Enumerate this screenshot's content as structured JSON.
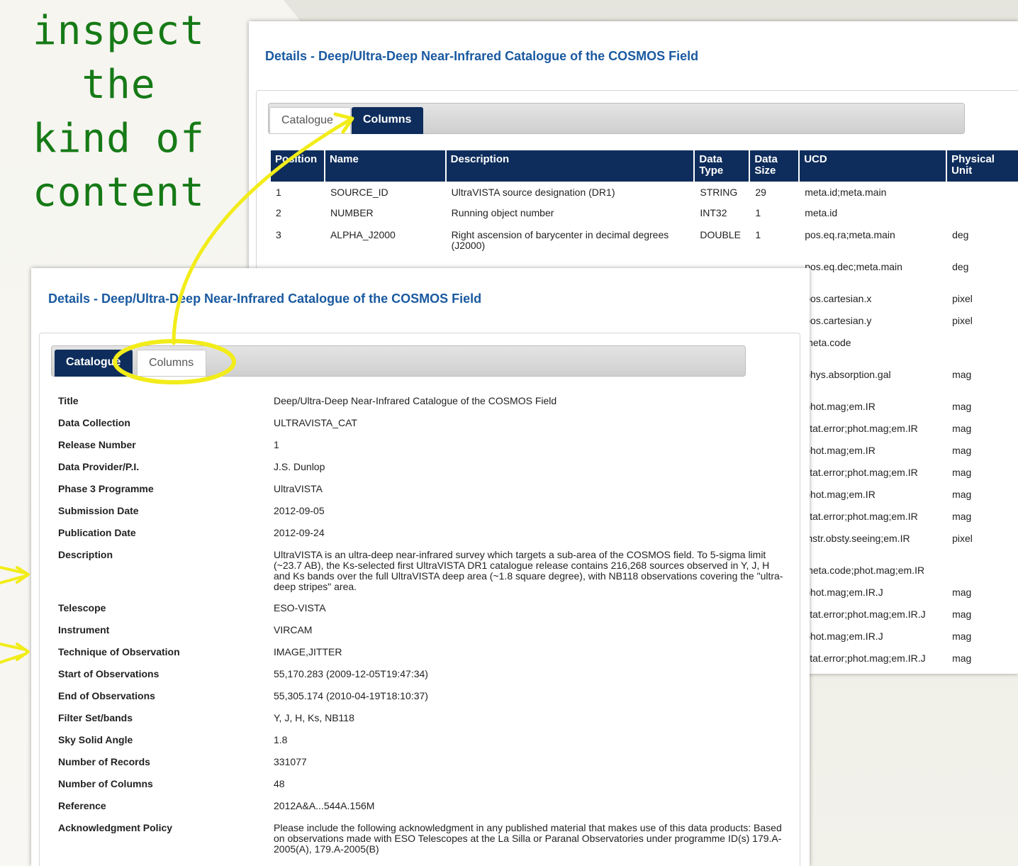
{
  "annotation": {
    "headline_lines": [
      "inspect the",
      "kind of",
      "content"
    ],
    "accent_color": "#167a16",
    "highlight_color": "#f2ec1a"
  },
  "columns_view": {
    "heading": "Details - Deep/Ultra-Deep Near-Infrared Catalogue of the COSMOS Field",
    "tabs": {
      "catalogue": "Catalogue",
      "columns": "Columns"
    },
    "table": {
      "headers": [
        "Position",
        "Name",
        "Description",
        "Data Type",
        "Data Size",
        "UCD",
        "Physical Unit"
      ],
      "rows": [
        {
          "position": "1",
          "name": "SOURCE_ID",
          "description": "UltraVISTA source designation (DR1)",
          "type": "STRING",
          "size": "29",
          "ucd": "meta.id;meta.main",
          "unit": ""
        },
        {
          "position": "2",
          "name": "NUMBER",
          "description": "Running object number",
          "type": "INT32",
          "size": "1",
          "ucd": "meta.id",
          "unit": ""
        },
        {
          "position": "3",
          "name": "ALPHA_J2000",
          "description": "Right ascension of barycenter in decimal degrees (J2000)",
          "type": "DOUBLE",
          "size": "1",
          "ucd": "pos.eq.ra;meta.main",
          "unit": "deg"
        },
        {
          "position": "",
          "name": "",
          "description": "",
          "type": "",
          "size": "",
          "ucd": "pos.eq.dec;meta.main",
          "unit": "deg"
        },
        {
          "position": "",
          "name": "",
          "description": "",
          "type": "",
          "size": "",
          "ucd": "pos.cartesian.x",
          "unit": "pixel"
        },
        {
          "position": "",
          "name": "",
          "description": "",
          "type": "",
          "size": "",
          "ucd": "pos.cartesian.y",
          "unit": "pixel"
        },
        {
          "position": "",
          "name": "",
          "description": "",
          "type": "",
          "size": "",
          "ucd": "meta.code",
          "unit": ""
        },
        {
          "position": "",
          "name": "",
          "description": "",
          "type": "",
          "size": "",
          "ucd": "phys.absorption.gal",
          "unit": "mag"
        },
        {
          "position": "",
          "name": "",
          "description": "",
          "type": "",
          "size": "",
          "ucd": "phot.mag;em.IR",
          "unit": "mag"
        },
        {
          "position": "",
          "name": "",
          "description": "",
          "type": "",
          "size": "",
          "ucd": "stat.error;phot.mag;em.IR",
          "unit": "mag"
        },
        {
          "position": "",
          "name": "",
          "description": "",
          "type": "",
          "size": "",
          "ucd": "phot.mag;em.IR",
          "unit": "mag"
        },
        {
          "position": "",
          "name": "",
          "description": "",
          "type": "",
          "size": "",
          "ucd": "stat.error;phot.mag;em.IR",
          "unit": "mag"
        },
        {
          "position": "",
          "name": "",
          "description": "",
          "type": "",
          "size": "",
          "ucd": "phot.mag;em.IR",
          "unit": "mag"
        },
        {
          "position": "",
          "name": "",
          "description": "",
          "type": "",
          "size": "",
          "ucd": "stat.error;phot.mag;em.IR",
          "unit": "mag"
        },
        {
          "position": "",
          "name": "",
          "description": "",
          "type": "",
          "size": "",
          "ucd": "instr.obsty.seeing;em.IR",
          "unit": "pixel"
        },
        {
          "position": "",
          "name": "",
          "description": "",
          "type": "",
          "size": "",
          "ucd": "meta.code;phot.mag;em.IR",
          "unit": ""
        },
        {
          "position": "",
          "name": "",
          "description": "",
          "type": "",
          "size": "",
          "ucd": "phot.mag;em.IR.J",
          "unit": "mag"
        },
        {
          "position": "",
          "name": "",
          "description": "",
          "type": "",
          "size": "",
          "ucd": "stat.error;phot.mag;em.IR.J",
          "unit": "mag"
        },
        {
          "position": "",
          "name": "",
          "description": "",
          "type": "",
          "size": "",
          "ucd": "phot.mag;em.IR.J",
          "unit": "mag"
        },
        {
          "position": "",
          "name": "",
          "description": "",
          "type": "",
          "size": "",
          "ucd": "stat.error;phot.mag;em.IR.J",
          "unit": "mag"
        }
      ]
    }
  },
  "catalogue_view": {
    "heading": "Details - Deep/Ultra-Deep Near-Infrared Catalogue of the COSMOS Field",
    "tabs": {
      "catalogue": "Catalogue",
      "columns": "Columns"
    },
    "fields": [
      {
        "label": "Title",
        "value": "Deep/Ultra-Deep Near-Infrared Catalogue of the COSMOS Field"
      },
      {
        "label": "Data Collection",
        "value": "ULTRAVISTA_CAT"
      },
      {
        "label": "Release Number",
        "value": "1"
      },
      {
        "label": "Data Provider/P.I.",
        "value": "J.S. Dunlop"
      },
      {
        "label": "Phase 3 Programme",
        "value": "UltraVISTA"
      },
      {
        "label": "Submission Date",
        "value": "2012-09-05"
      },
      {
        "label": "Publication Date",
        "value": "2012-09-24"
      },
      {
        "label": "Description",
        "value": "UltraVISTA is an ultra-deep near-infrared survey which targets a sub-area of the COSMOS field. To 5-sigma limit (~23.7 AB), the Ks-selected first UltraVISTA DR1 catalogue release contains 216,268 sources observed in Y, J, H and Ks bands over the full UltraVISTA deep area (~1.8 square degree), with NB118 observations covering the \"ultra-deep stripes\" area."
      },
      {
        "label": "Telescope",
        "value": "ESO-VISTA"
      },
      {
        "label": "Instrument",
        "value": "VIRCAM"
      },
      {
        "label": "Technique of Observation",
        "value": "IMAGE,JITTER"
      },
      {
        "label": "Start of Observations",
        "value": "55,170.283 (2009-12-05T19:47:34)"
      },
      {
        "label": "End of Observations",
        "value": "55,305.174 (2010-04-19T18:10:37)"
      },
      {
        "label": "Filter Set/bands",
        "value": "Y, J, H, Ks, NB118"
      },
      {
        "label": "Sky Solid Angle",
        "value": "1.8"
      },
      {
        "label": "Number of Records",
        "value": "331077"
      },
      {
        "label": "Number of Columns",
        "value": "48"
      },
      {
        "label": "Reference",
        "value": "2012A&A...544A.156M"
      },
      {
        "label": "Acknowledgment Policy",
        "value": "Please include the following acknowledgment in any published material that makes use of this data products: Based on observations made with ESO Telescopes at the La Silla or Paranal Observatories under programme ID(s) 179.A-2005(A), 179.A-2005(B)"
      }
    ]
  }
}
